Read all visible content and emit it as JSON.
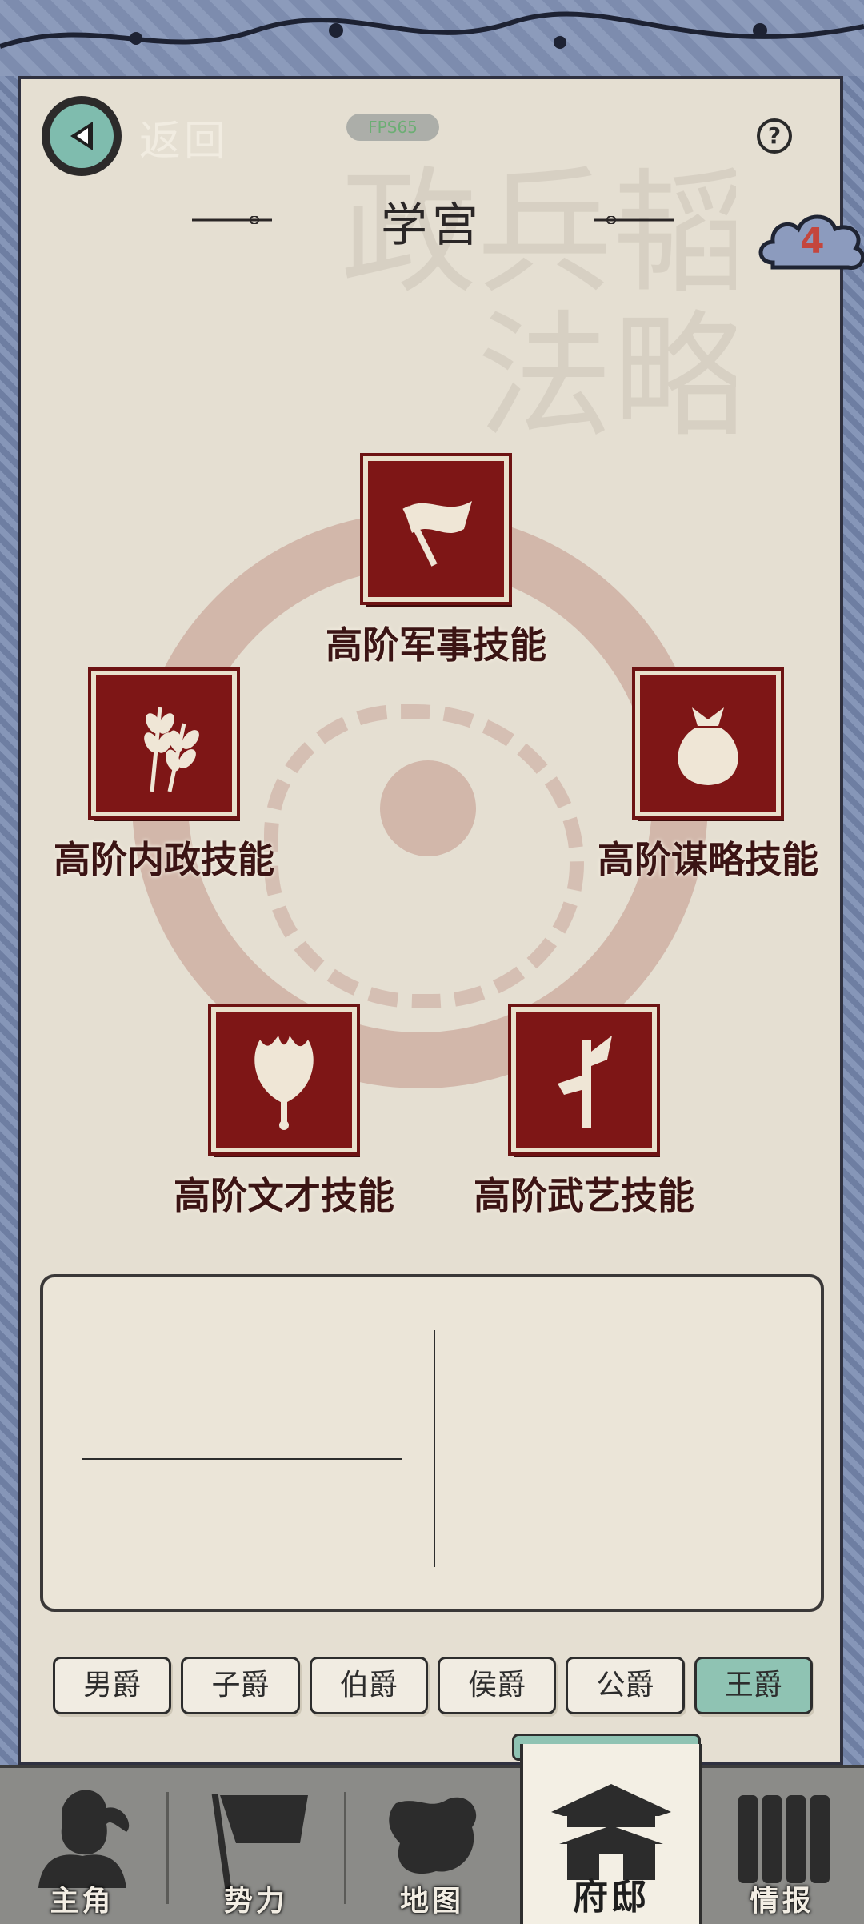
{
  "header": {
    "back_label": "返回",
    "fps": "FPS65",
    "help": "?",
    "title": "学宫",
    "badge_count": "4"
  },
  "skills": [
    {
      "label": "高阶军事技能",
      "icon": "flag-icon"
    },
    {
      "label": "高阶内政技能",
      "icon": "wheat-icon"
    },
    {
      "label": "高阶谋略技能",
      "icon": "money-bag-icon"
    },
    {
      "label": "高阶文才技能",
      "icon": "feather-fan-icon"
    },
    {
      "label": "高阶武艺技能",
      "icon": "halberd-icon"
    }
  ],
  "ranks": [
    {
      "label": "男爵",
      "active": false
    },
    {
      "label": "子爵",
      "active": false
    },
    {
      "label": "伯爵",
      "active": false
    },
    {
      "label": "侯爵",
      "active": false
    },
    {
      "label": "公爵",
      "active": false
    },
    {
      "label": "王爵",
      "active": true
    }
  ],
  "nav": [
    {
      "label": "主角",
      "icon": "warrior-icon"
    },
    {
      "label": "势力",
      "icon": "banner-icon"
    },
    {
      "label": "地图",
      "icon": "map-icon"
    },
    {
      "label": "府邸",
      "icon": "mansion-icon",
      "active": true
    },
    {
      "label": "情报",
      "icon": "scrolls-icon"
    }
  ],
  "colors": {
    "seal_red": "#7e1616",
    "accent_teal": "#8fc3b3",
    "paper": "#e5dfd2",
    "border_blue": "#7d8cae"
  }
}
